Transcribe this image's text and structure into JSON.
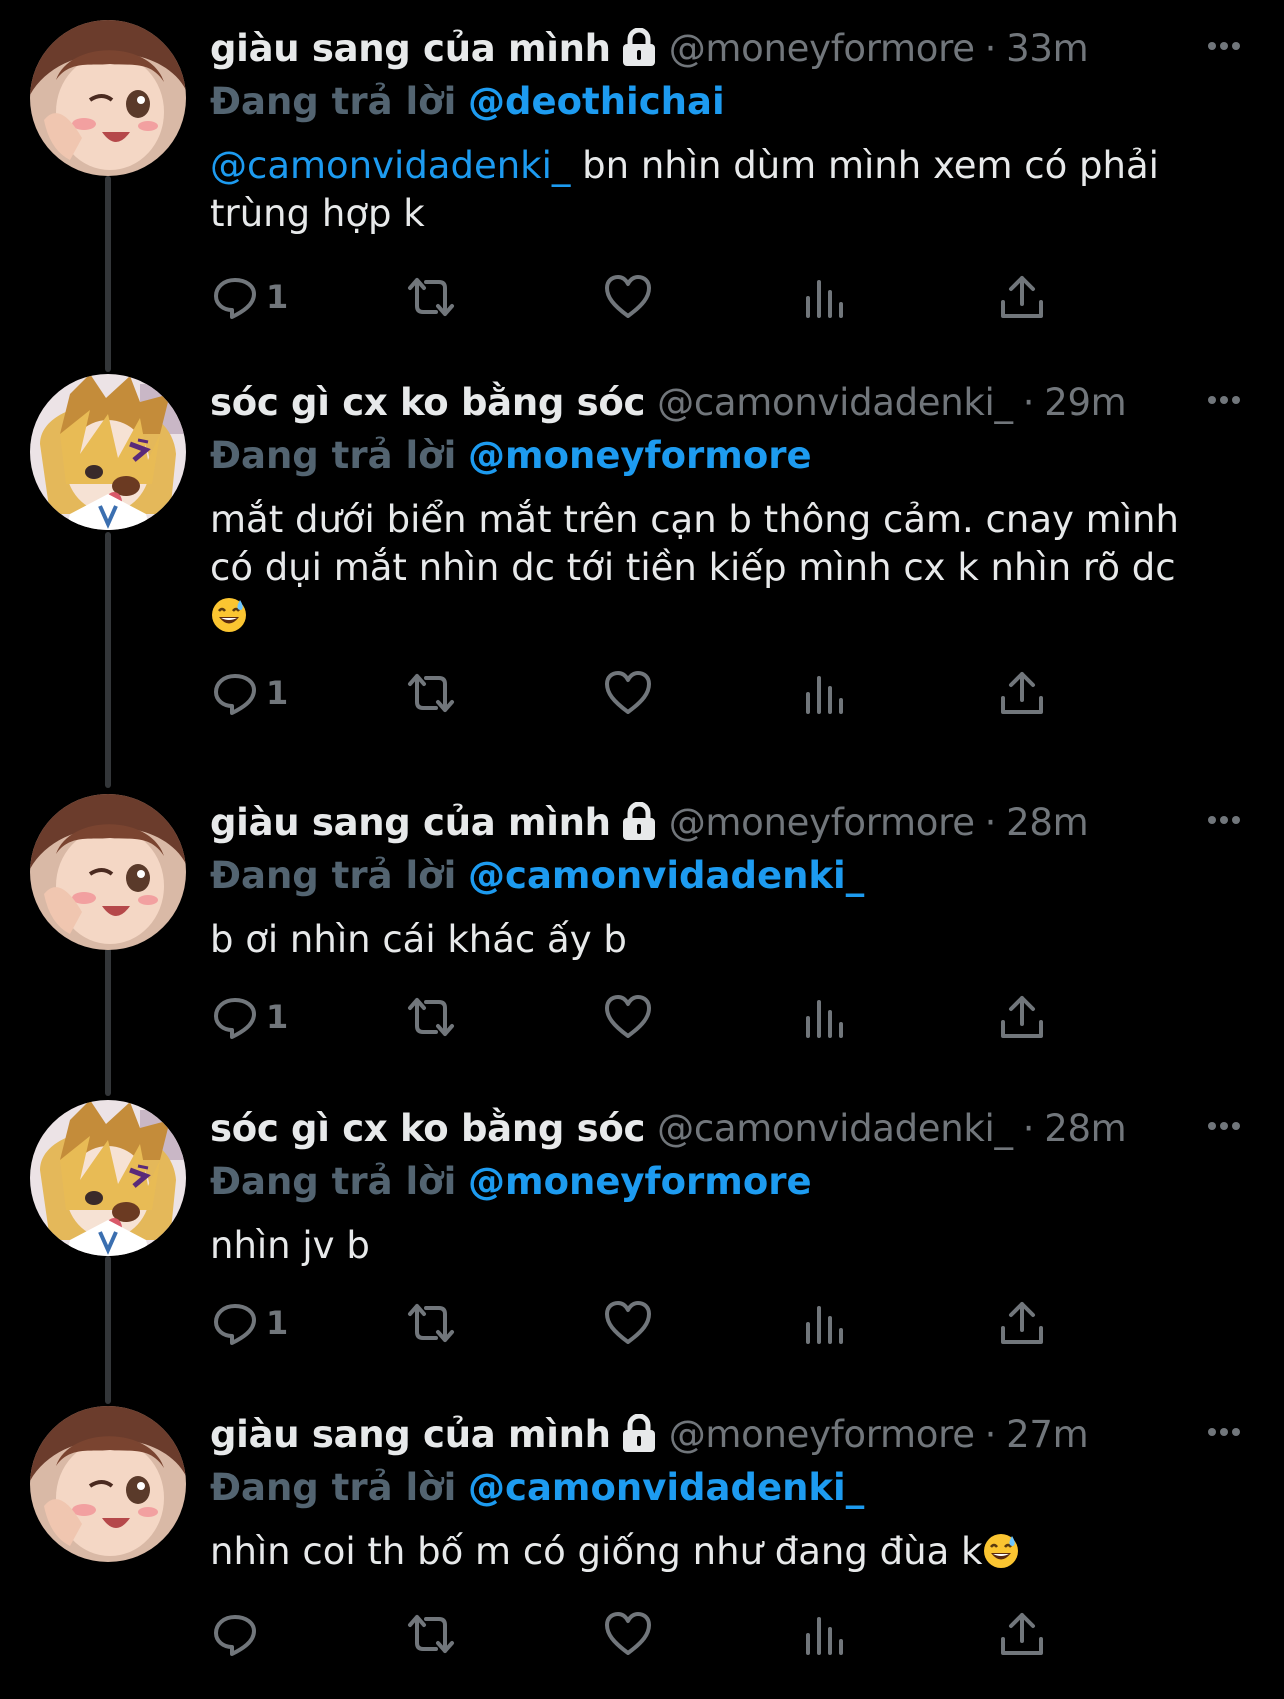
{
  "colors": {
    "background": "#000000",
    "text": "#e7e9ea",
    "muted": "#71767b",
    "replying_prefix": "#536471",
    "mention": "#1d9bf0",
    "thread_line": "#333639"
  },
  "replying_prefix": "Đang trả lời",
  "tweets": [
    {
      "name": "giàu sang của mình",
      "protected": true,
      "handle": "@moneyformore",
      "separator": "·",
      "time": "33m",
      "reply_to": "@deothichai",
      "mention": "@camonvidadenki_",
      "text": " bn nhìn dùm mình xem có phải\ntrùng hợp k",
      "reply_count": "1",
      "avatar": "avatar-girl-icon"
    },
    {
      "name": "sóc gì cx ko bằng sóc",
      "protected": false,
      "handle": "@camonvidadenki_",
      "separator": "·",
      "time": "29m",
      "reply_to": "@moneyformore",
      "text": "mắt dưới biển mắt trên cạn b thông cảm. cnay mình\ncó dụi mắt nhìn dc tới tiền kiếp mình cx k nhìn rõ dc\n",
      "emoji": "sweat-smile-emoji",
      "reply_count": "1",
      "avatar": "avatar-blonde-boy-icon"
    },
    {
      "name": "giàu sang của mình",
      "protected": true,
      "handle": "@moneyformore",
      "separator": "·",
      "time": "28m",
      "reply_to": "@camonvidadenki_",
      "text": "b ơi nhìn cái khác ấy b",
      "reply_count": "1",
      "avatar": "avatar-girl-icon"
    },
    {
      "name": "sóc gì cx ko bằng sóc",
      "protected": false,
      "handle": "@camonvidadenki_",
      "separator": "·",
      "time": "28m",
      "reply_to": "@moneyformore",
      "text": "nhìn jv b",
      "reply_count": "1",
      "avatar": "avatar-blonde-boy-icon"
    },
    {
      "name": "giàu sang của mình",
      "protected": true,
      "handle": "@moneyformore",
      "separator": "·",
      "time": "27m",
      "reply_to": "@camonvidadenki_",
      "text": "nhìn coi th bố m có giống như đang đùa k",
      "emoji": "sweat-smile-emoji",
      "reply_count": "",
      "avatar": "avatar-girl-icon"
    }
  ],
  "icons": {
    "reply": "reply-icon",
    "retweet": "retweet-icon",
    "like": "like-icon",
    "views": "views-icon",
    "share": "share-icon",
    "more": "more-icon",
    "lock": "lock-icon"
  }
}
